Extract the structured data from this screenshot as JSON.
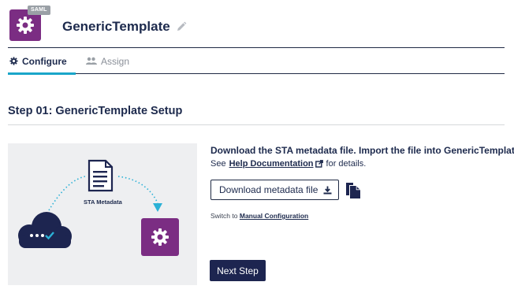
{
  "header": {
    "badge": "SAML",
    "app_name": "GenericTemplate",
    "app_icon": "gear-icon",
    "edit_icon": "pencil-icon"
  },
  "tabs": [
    {
      "label": "Configure",
      "icon": "gear-icon",
      "active": true
    },
    {
      "label": "Assign",
      "icon": "users-icon",
      "active": false
    }
  ],
  "step": {
    "title": "Step 01: GenericTemplate Setup"
  },
  "illustration": {
    "label": "STA Metadata",
    "icons": [
      "document-icon",
      "cloud-icon",
      "gear-icon"
    ]
  },
  "content": {
    "instruction": "Download the STA metadata file. Import the file into GenericTemplate.",
    "see_prefix": "See",
    "help_link": "Help Documentation",
    "see_suffix": "for details.",
    "download_button": "Download metadata file",
    "switch_prefix": "Switch to",
    "manual_link": "Manual Configuration",
    "next_button": "Next Step"
  },
  "colors": {
    "brand_purple": "#7b2d83",
    "navy": "#1d2550",
    "tab_accent": "#1aa6c9",
    "badge_gray": "#9aa0a6"
  }
}
